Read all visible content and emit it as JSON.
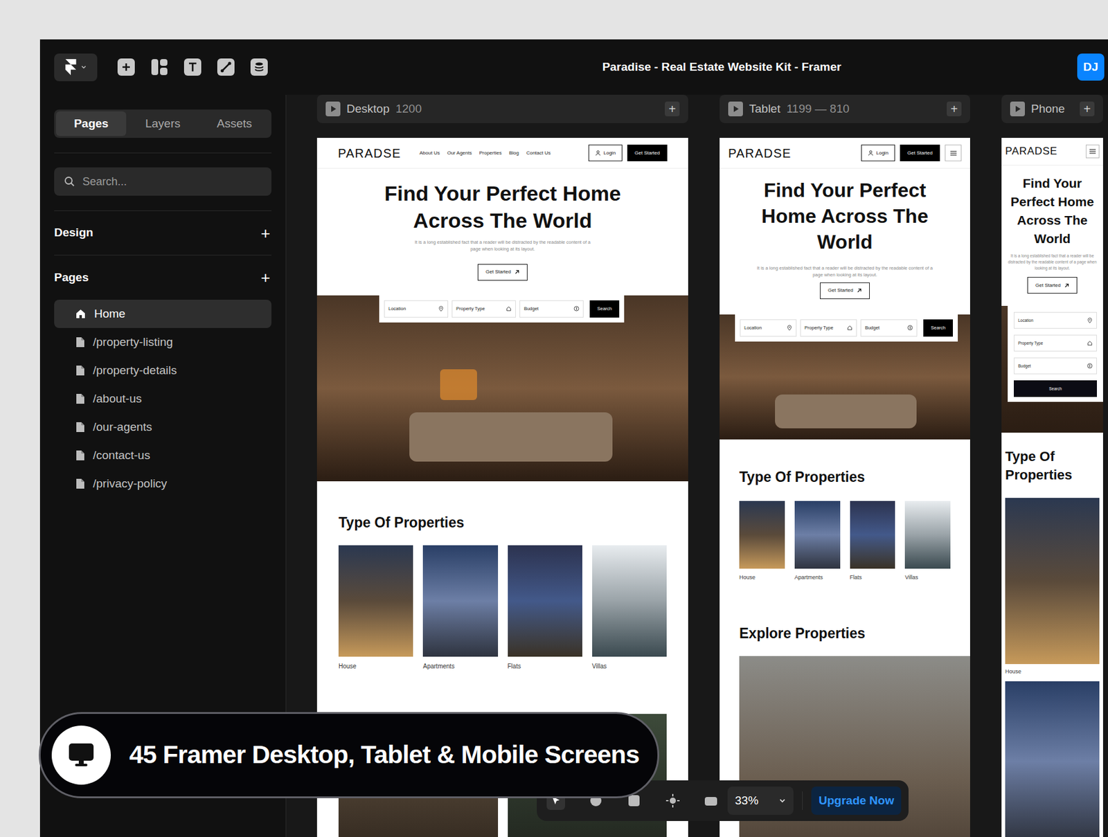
{
  "window": {
    "title": "Paradise - Real Estate Website Kit - Framer",
    "avatar": "DJ"
  },
  "sidebar": {
    "tabs": [
      {
        "label": "Pages",
        "selected": true
      },
      {
        "label": "Layers",
        "selected": false
      },
      {
        "label": "Assets",
        "selected": false
      }
    ],
    "search": {
      "placeholder": "Search..."
    },
    "sections": [
      {
        "label": "Design",
        "action": "+"
      },
      {
        "label": "Pages",
        "action": "+"
      }
    ],
    "pages": [
      {
        "label": "Home",
        "kind": "home",
        "selected": true
      },
      {
        "label": "/property-listing",
        "kind": "page",
        "selected": false
      },
      {
        "label": "/property-details",
        "kind": "page",
        "selected": false
      },
      {
        "label": "/about-us",
        "kind": "page",
        "selected": false
      },
      {
        "label": "/our-agents",
        "kind": "page",
        "selected": false
      },
      {
        "label": "/contact-us",
        "kind": "page",
        "selected": false
      },
      {
        "label": "/privacy-policy",
        "kind": "page",
        "selected": false
      }
    ]
  },
  "breakpoints": [
    {
      "name": "Desktop",
      "size": "1200",
      "action": "+"
    },
    {
      "name": "Tablet",
      "size": "1199 — 810",
      "action": "+"
    },
    {
      "name": "Phone",
      "size": "",
      "action": "+"
    }
  ],
  "site": {
    "logo": "PARADSE",
    "nav": [
      "About Us",
      "Our Agents",
      "Properties",
      "Blog",
      "Contact Us"
    ],
    "login": "Login",
    "cta": "Get Started",
    "hero_title": "Find Your Perfect Home Across The World",
    "hero_text": "It is a long established fact that a reader will be distracted by the readable content of a page when looking at its layout.",
    "hero_button": "Get Started",
    "search_fields": [
      "Location",
      "Property Type",
      "Budget"
    ],
    "search_button": "Search",
    "types_title": "Type Of Properties",
    "types": [
      "House",
      "Apartments",
      "Flats",
      "Villas"
    ],
    "explore_title": "Explore Properties"
  },
  "badge": "45 Framer Desktop, Tablet & Mobile Screens",
  "toolbar": {
    "zoom": "33%",
    "upgrade": "Upgrade Now"
  }
}
